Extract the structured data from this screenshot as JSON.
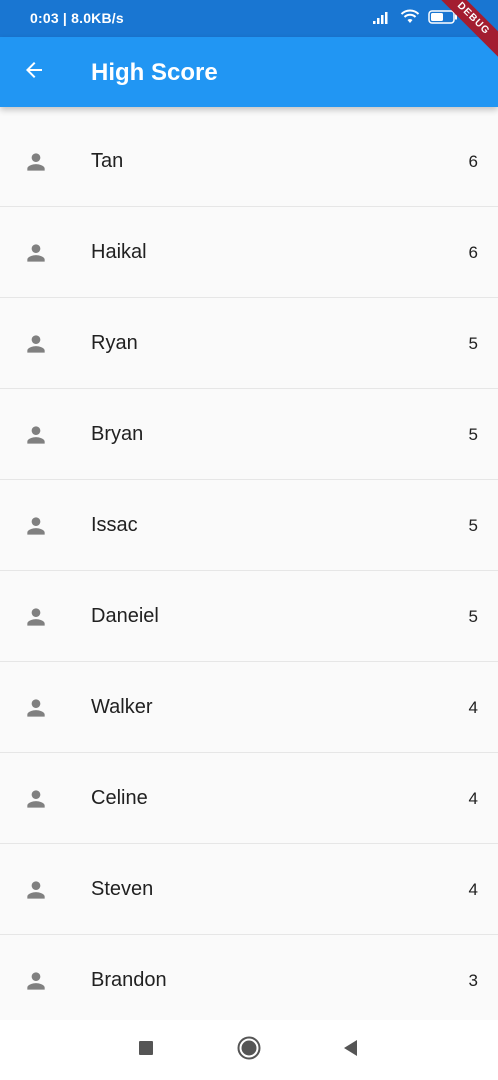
{
  "status_bar": {
    "text": "0:03 | 8.0KB/s",
    "battery_level": "53"
  },
  "debug_banner": "DEBUG",
  "app_bar": {
    "title": "High Score"
  },
  "colors": {
    "status_bar": "#1976d2",
    "app_bar": "#2196f3",
    "icon_gray": "#808080",
    "text": "#212121"
  },
  "scores": [
    {
      "name": "Tan",
      "score": "6",
      "icon": "person-icon"
    },
    {
      "name": "Haikal",
      "score": "6",
      "icon": "person-icon"
    },
    {
      "name": "Ryan",
      "score": "5",
      "icon": "person-icon"
    },
    {
      "name": "Bryan",
      "score": "5",
      "icon": "person-icon"
    },
    {
      "name": "Issac",
      "score": "5",
      "icon": "person-icon"
    },
    {
      "name": "Daneiel",
      "score": "5",
      "icon": "person-icon"
    },
    {
      "name": "Walker",
      "score": "4",
      "icon": "person-icon"
    },
    {
      "name": "Celine",
      "score": "4",
      "icon": "person-icon"
    },
    {
      "name": "Steven",
      "score": "4",
      "icon": "person-icon"
    },
    {
      "name": "Brandon",
      "score": "3",
      "icon": "person-icon"
    }
  ],
  "nav_bar": {
    "buttons": [
      "recents-square-icon",
      "home-circle-icon",
      "back-triangle-icon"
    ]
  }
}
